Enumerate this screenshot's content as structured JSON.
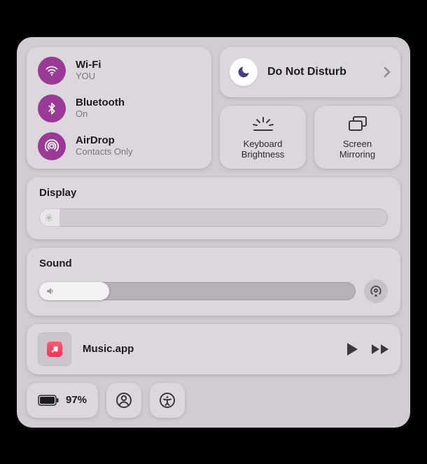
{
  "connectivity": {
    "wifi": {
      "title": "Wi-Fi",
      "subtitle": "YOU"
    },
    "bluetooth": {
      "title": "Bluetooth",
      "subtitle": "On"
    },
    "airdrop": {
      "title": "AirDrop",
      "subtitle": "Contacts Only"
    }
  },
  "dnd": {
    "label": "Do Not Disturb"
  },
  "keyboard_brightness": {
    "label": "Keyboard Brightness"
  },
  "screen_mirroring": {
    "label": "Screen Mirroring"
  },
  "display": {
    "title": "Display",
    "value_pct": 5
  },
  "sound": {
    "title": "Sound",
    "value_pct": 20
  },
  "music": {
    "app": "Music.app"
  },
  "battery": {
    "label": "97%"
  },
  "colors": {
    "accent": "#9b3a96"
  }
}
